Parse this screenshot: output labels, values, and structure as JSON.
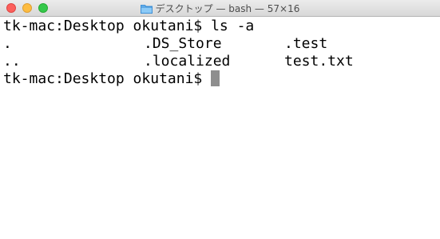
{
  "window": {
    "title": "デスクトップ — bash — 57×16",
    "folder_icon": "folder-icon",
    "colors": {
      "close": "#fc605c",
      "minimize": "#fdbc40",
      "zoom": "#34c84a"
    }
  },
  "terminal": {
    "command_line": "tk-mac:Desktop okutani$ ls -a",
    "listing": [
      [
        ".",
        ".DS_Store",
        ".test"
      ],
      [
        "..",
        ".localized",
        "test.txt"
      ]
    ],
    "prompt": "tk-mac:Desktop okutani$"
  }
}
